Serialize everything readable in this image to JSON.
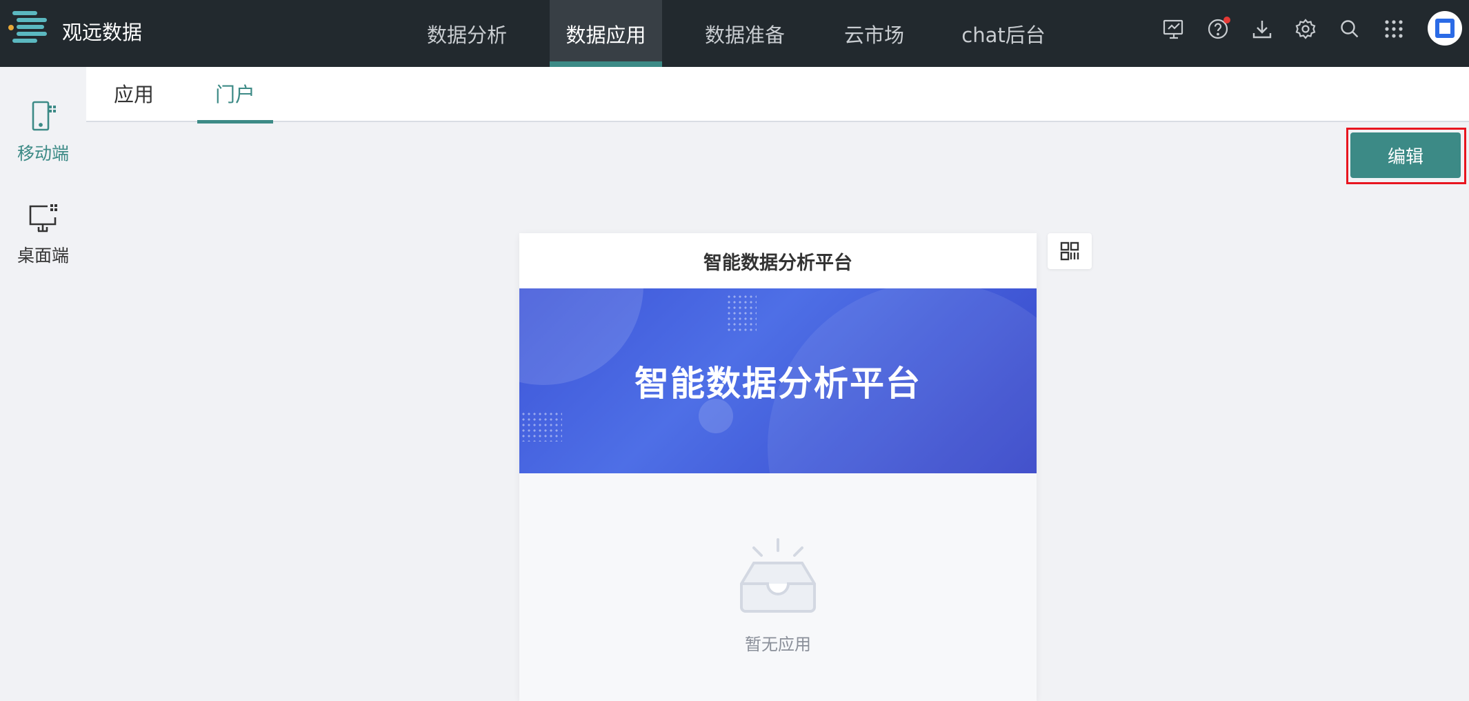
{
  "header": {
    "brand": "观远数据",
    "nav": [
      "数据分析",
      "数据应用",
      "数据准备",
      "云市场",
      "chat后台"
    ],
    "active_nav": "数据应用",
    "icons": [
      "monitor-icon",
      "help-icon",
      "download-icon",
      "gear-icon",
      "search-icon",
      "apps-grid-icon",
      "avatar"
    ]
  },
  "sidebar": {
    "items": [
      {
        "label": "移动端",
        "icon": "mobile-icon",
        "active": true
      },
      {
        "label": "桌面端",
        "icon": "desktop-icon",
        "active": false
      }
    ]
  },
  "tabs": {
    "items": [
      "应用",
      "门户"
    ],
    "active": "门户"
  },
  "toolbar": {
    "edit_label": "编辑"
  },
  "portal": {
    "title": "智能数据分析平台",
    "banner_title": "智能数据分析平台",
    "empty_text": "暂无应用"
  },
  "colors": {
    "topbar": "#22292e",
    "accent": "#3c8a86",
    "highlight_border": "#e8151f",
    "banner": "#3d55d8"
  }
}
